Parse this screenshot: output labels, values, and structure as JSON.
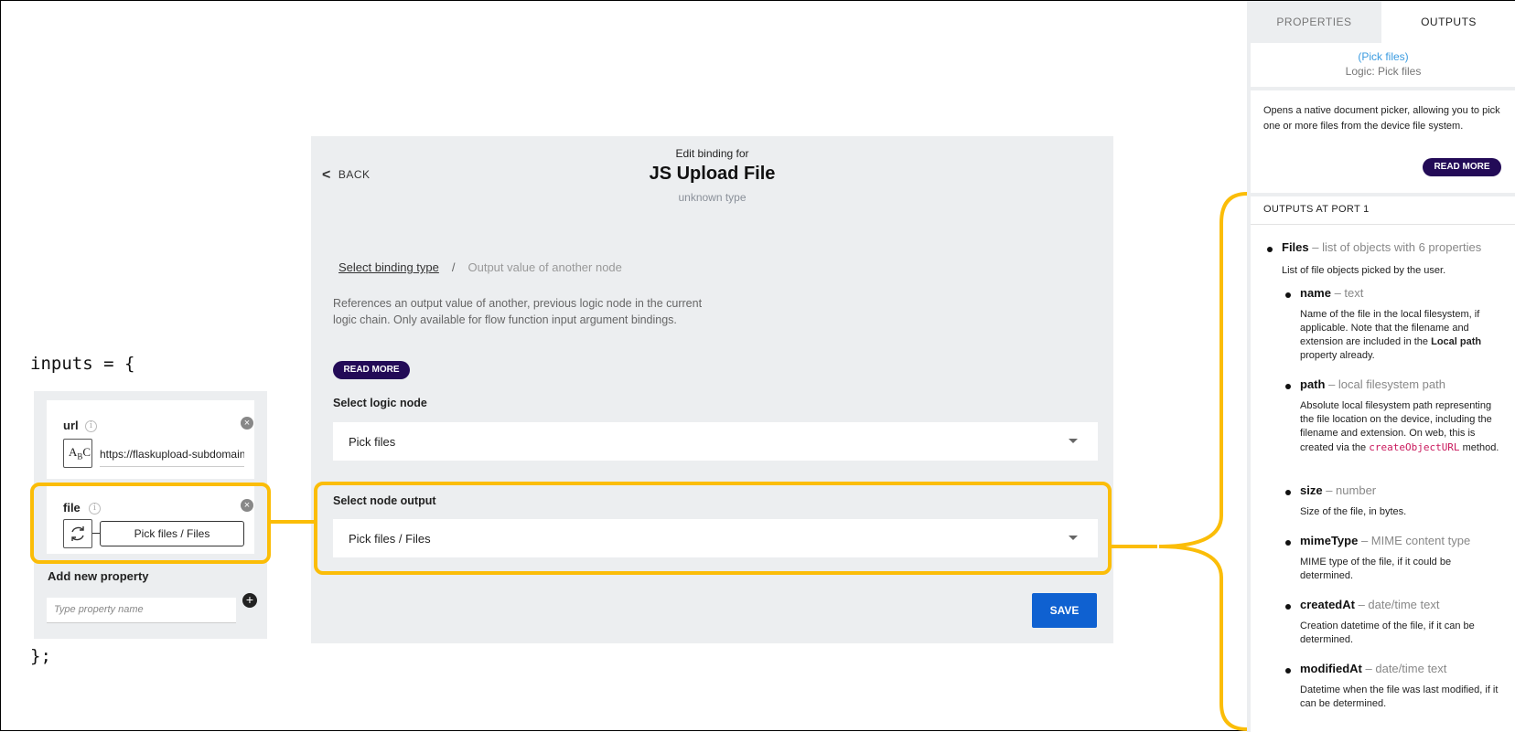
{
  "code": {
    "open": "inputs = {",
    "close": "};"
  },
  "properties": {
    "url": {
      "name": "url",
      "type_glyph": "ABC",
      "value": "https://flaskupload-subdomain"
    },
    "file": {
      "name": "file",
      "value": "Pick files / Files"
    },
    "add_new_label": "Add new property",
    "add_new_placeholder": "Type property name"
  },
  "dialog": {
    "back_label": "BACK",
    "caption": "Edit binding for",
    "title": "JS Upload File",
    "type_label": "unknown type",
    "breadcrumb": {
      "link": "Select binding type",
      "separator": "/",
      "current": "Output value of another node"
    },
    "description": "References an output value of another, previous logic node in the current logic chain. Only available for flow function input argument bindings.",
    "read_more": "READ MORE",
    "logic_node_label": "Select logic node",
    "logic_node_value": "Pick files",
    "node_output_label": "Select node output",
    "node_output_value": "Pick files / Files",
    "save_label": "SAVE"
  },
  "right_panel": {
    "tabs": [
      "PROPERTIES",
      "OUTPUTS"
    ],
    "active_tab": "OUTPUTS",
    "node_link": "(Pick files)",
    "node_logic": "Logic: Pick files",
    "description": "Opens a native document picker, allowing you to pick one or more files from the device file system.",
    "read_more": "READ MORE",
    "ports_title": "OUTPUTS AT PORT 1",
    "files": {
      "name": "Files",
      "type": "– list of objects with 6 properties",
      "desc": "List of file objects picked by the user."
    },
    "outputs": [
      {
        "name": "name",
        "type": "– text",
        "desc_before": "Name of the file in the local filesystem, if applicable. Note that the filename and extension are included in the ",
        "desc_bold": "Local path",
        "desc_after": " property already."
      },
      {
        "name": "path",
        "type": "– local filesystem path",
        "desc_before": "Absolute local filesystem path representing the file location on the device, including the filename and extension. On web, this is created via the ",
        "desc_code": "createObjectURL",
        "desc_after": " method."
      },
      {
        "name": "size",
        "type": "– number",
        "desc": "Size of the file, in bytes."
      },
      {
        "name": "mimeType",
        "type": "– MIME content type",
        "desc": "MIME type of the file, if it could be determined."
      },
      {
        "name": "createdAt",
        "type": "– date/time text",
        "desc": "Creation datetime of the file, if it can be determined."
      },
      {
        "name": "modifiedAt",
        "type": "– date/time text",
        "desc": "Datetime when the file was last modified, if it can be determined."
      }
    ]
  },
  "colors": {
    "accent": "#fbbd08",
    "save": "#0f61d1",
    "pill": "#230b57",
    "panel": "#eceef0"
  }
}
